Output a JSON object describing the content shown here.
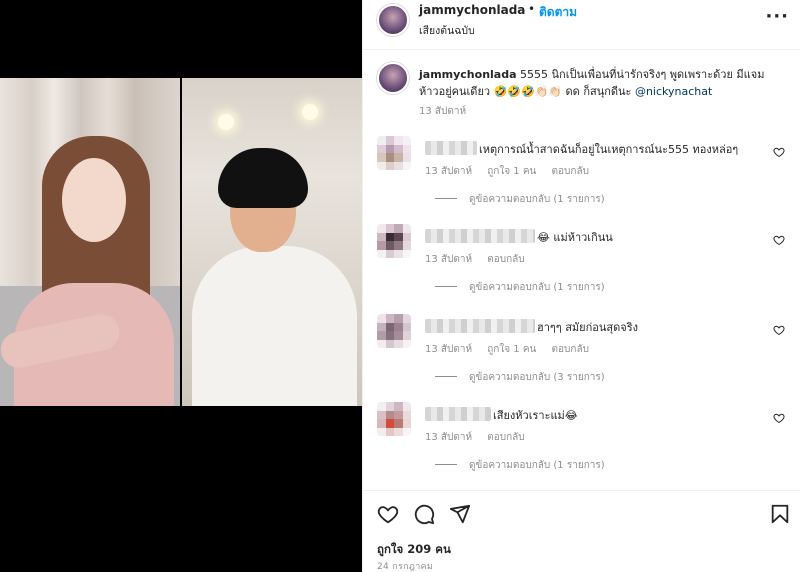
{
  "header": {
    "username": "jammychonlada",
    "separator": "•",
    "follow_label": "ติดตาม",
    "audio_label": "เสียงต้นฉบับ",
    "more_label": "···"
  },
  "caption": {
    "username": "jammychonlada",
    "text_line1": "5555 นิกเป็นเพื่อนที่น่ารักจริงๆ พูดเพราะด้วย มีแจม",
    "text_line2": "ห้าวอยู่คนเดียว 🤣🤣🤣👏🏻👏🏻 ดด ก็สนุกดีนะ",
    "mention": "@nickynachat",
    "time": "13 สัปดาห์"
  },
  "comments": [
    {
      "text": "เหตุการณ์น้ำสาดฉันก็อยู่ในเหตุการณ์นะ555 ทองหล่อๆ",
      "time": "13 สัปดาห์",
      "likes": "ถูกใจ 1 คน",
      "reply_label": "ตอบกลับ",
      "view_replies": "ดูข้อความตอบกลับ (1 รายการ)"
    },
    {
      "text": "😂 แม่ห้าวเกินน",
      "time": "13 สัปดาห์",
      "likes": "",
      "reply_label": "ตอบกลับ",
      "view_replies": "ดูข้อความตอบกลับ (1 รายการ)"
    },
    {
      "text": "ฮาๆๆ สมัยก่อนสุดจริง",
      "time": "13 สัปดาห์",
      "likes": "ถูกใจ 1 คน",
      "reply_label": "ตอบกลับ",
      "view_replies": "ดูข้อความตอบกลับ (3 รายการ)"
    },
    {
      "text": "เสียงหัวเราะแม่😂",
      "time": "13 สัปดาห์",
      "likes": "",
      "reply_label": "ตอบกลับ",
      "view_replies": "ดูข้อความตอบกลับ (1 รายการ)"
    }
  ],
  "footer": {
    "likes": "ถูกใจ 209 คน",
    "date": "24 กรกฎาคม"
  },
  "icons": {
    "like": "heart-icon",
    "comment": "comment-icon",
    "share": "share-icon",
    "save": "bookmark-icon"
  },
  "colors": {
    "accent": "#0095f6",
    "mention": "#00376b",
    "muted": "#8e8e8e"
  }
}
